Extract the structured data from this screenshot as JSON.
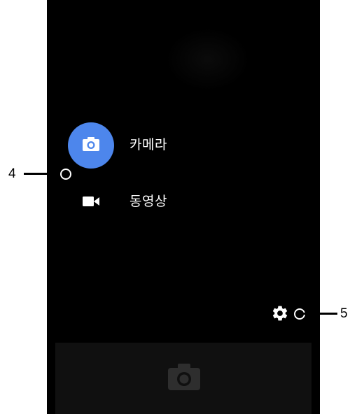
{
  "camera_app": {
    "modes": [
      {
        "label": "카메라",
        "icon": "camera-icon",
        "selected": true
      },
      {
        "label": "동영상",
        "icon": "video-icon",
        "selected": false
      }
    ],
    "settings_icon": "gear-icon",
    "shutter_icon": "camera-shutter-icon",
    "accent_color": "#4d86ec"
  },
  "callouts": {
    "left_number": "4",
    "right_number": "5"
  }
}
